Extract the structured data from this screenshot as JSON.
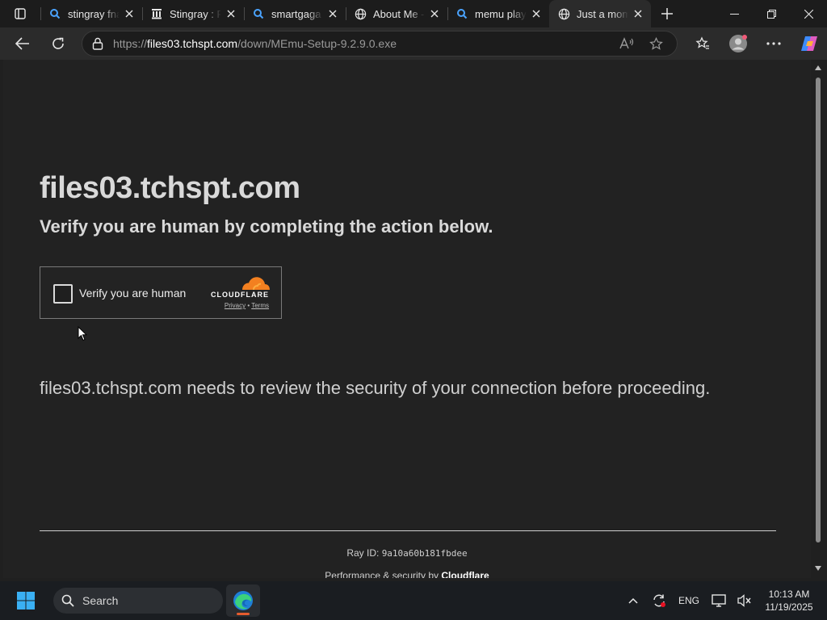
{
  "browser": {
    "tabs": [
      {
        "title": "stingray fnaf",
        "favicon": "search-icon",
        "active": false
      },
      {
        "title": "Stingray : Fr",
        "favicon": "archive-icon",
        "active": false
      },
      {
        "title": "smartgaga -",
        "favicon": "search-icon",
        "active": false
      },
      {
        "title": "About Me -",
        "favicon": "globe-icon",
        "active": false
      },
      {
        "title": "memu play",
        "favicon": "search-icon",
        "active": false
      },
      {
        "title": "Just a mome",
        "favicon": "globe-icon",
        "active": true
      }
    ],
    "address": {
      "scheme": "https://",
      "host": "files03.tchspt.com",
      "path": "/down/MEmu-Setup-9.2.9.0.exe"
    }
  },
  "page": {
    "site_title": "files03.tchspt.com",
    "subtitle": "Verify you are human by completing the action below.",
    "widget": {
      "checkbox_label": "Verify you are human",
      "brand": "CLOUDFLARE",
      "privacy": "Privacy",
      "link_separator": " • ",
      "terms": "Terms"
    },
    "review_text": "files03.tchspt.com needs to review the security of your connection before proceeding.",
    "ray_label": "Ray ID: ",
    "ray_id": "9a10a60b181fbdee",
    "perf_prefix": "Performance & security by ",
    "perf_brand": "Cloudflare"
  },
  "taskbar": {
    "search_label": "Search",
    "language": "ENG",
    "time": "10:13 AM",
    "date": "11/19/2025"
  },
  "colors": {
    "cloudflare_orange": "#f38020",
    "page_bg": "#222222",
    "edge_accent": "#e65c2e"
  }
}
